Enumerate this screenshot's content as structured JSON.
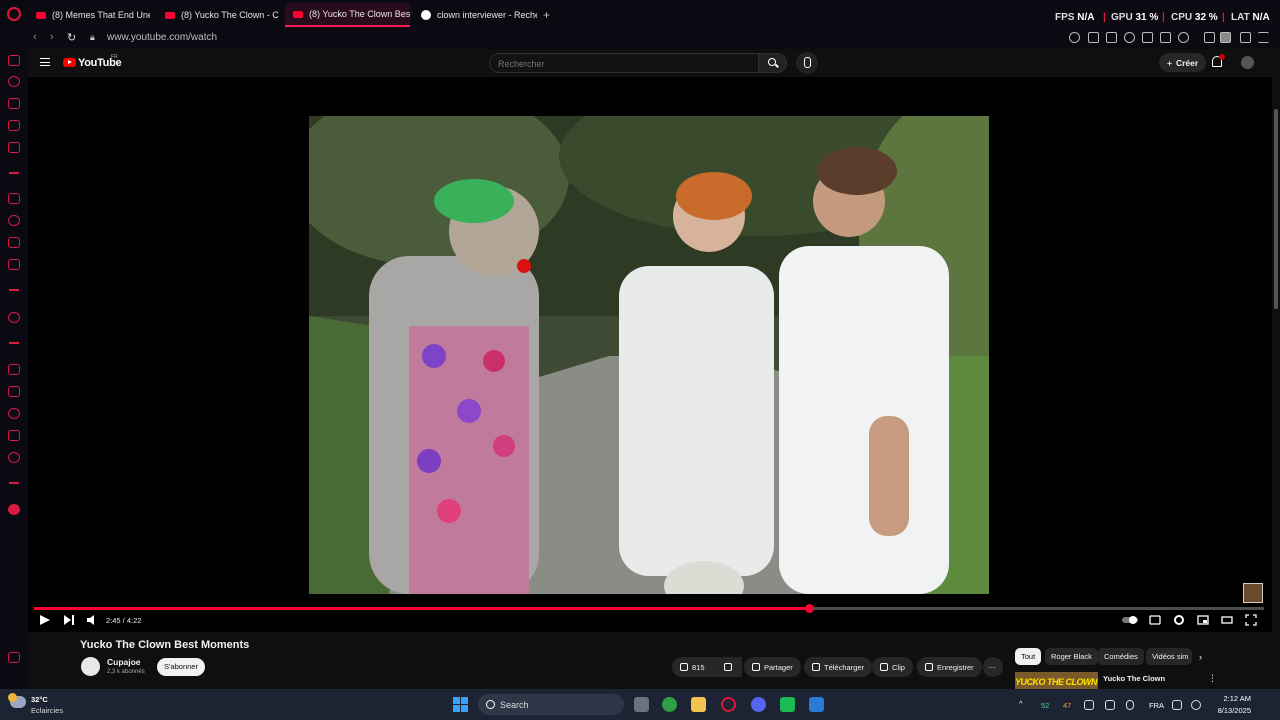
{
  "tabs": [
    {
      "label": "(8) Memes That End Une"
    },
    {
      "label": "(8) Yucko The Clown - C"
    },
    {
      "label": "(8) Yucko The Clown Bes"
    },
    {
      "label": "clown interviewer - Reche"
    }
  ],
  "stats": {
    "fps_label": "FPS",
    "fps_value": "N/A",
    "gpu_label": "GPU",
    "gpu_value": "31 %",
    "cpu_label": "CPU",
    "cpu_value": "32 %",
    "lat_label": "LAT",
    "lat_value": "N/A"
  },
  "address": {
    "url": "www.youtube.com/watch"
  },
  "youtube": {
    "logo_text": "YouTube",
    "logo_sup": "FR",
    "search_placeholder": "Rechercher",
    "create_label": "Créer",
    "notif_count": "9+"
  },
  "player": {
    "time": "2:45 / 4:22",
    "progress": 0.63
  },
  "video": {
    "title": "Yucko The Clown Best Moments",
    "channel": "Cupajoe",
    "subscribers": "2,3 k abonnés",
    "subscribe_label": "S'abonner",
    "likes": "815",
    "share_label": "Partager",
    "download_label": "Télécharger",
    "clip_label": "Clip",
    "save_label": "Enregistrer"
  },
  "chips": [
    "Tout",
    "Roger Black",
    "Comédies",
    "Vidéos sim"
  ],
  "recommendation": {
    "thumb_text": "YUCKO THE CLOWN",
    "title": "Yucko The Clown"
  },
  "taskbar": {
    "temp": "32°C",
    "condition": "Eclaircies",
    "search_label": "Search",
    "tray_num_1": "52",
    "tray_num_2": "47",
    "lang": "FRA",
    "time": "2:12 AM",
    "date": "8/13/2025"
  },
  "colors": {
    "accent": "#ff0033",
    "opera_red": "#e0163d",
    "taskbar": "#1c2333"
  }
}
